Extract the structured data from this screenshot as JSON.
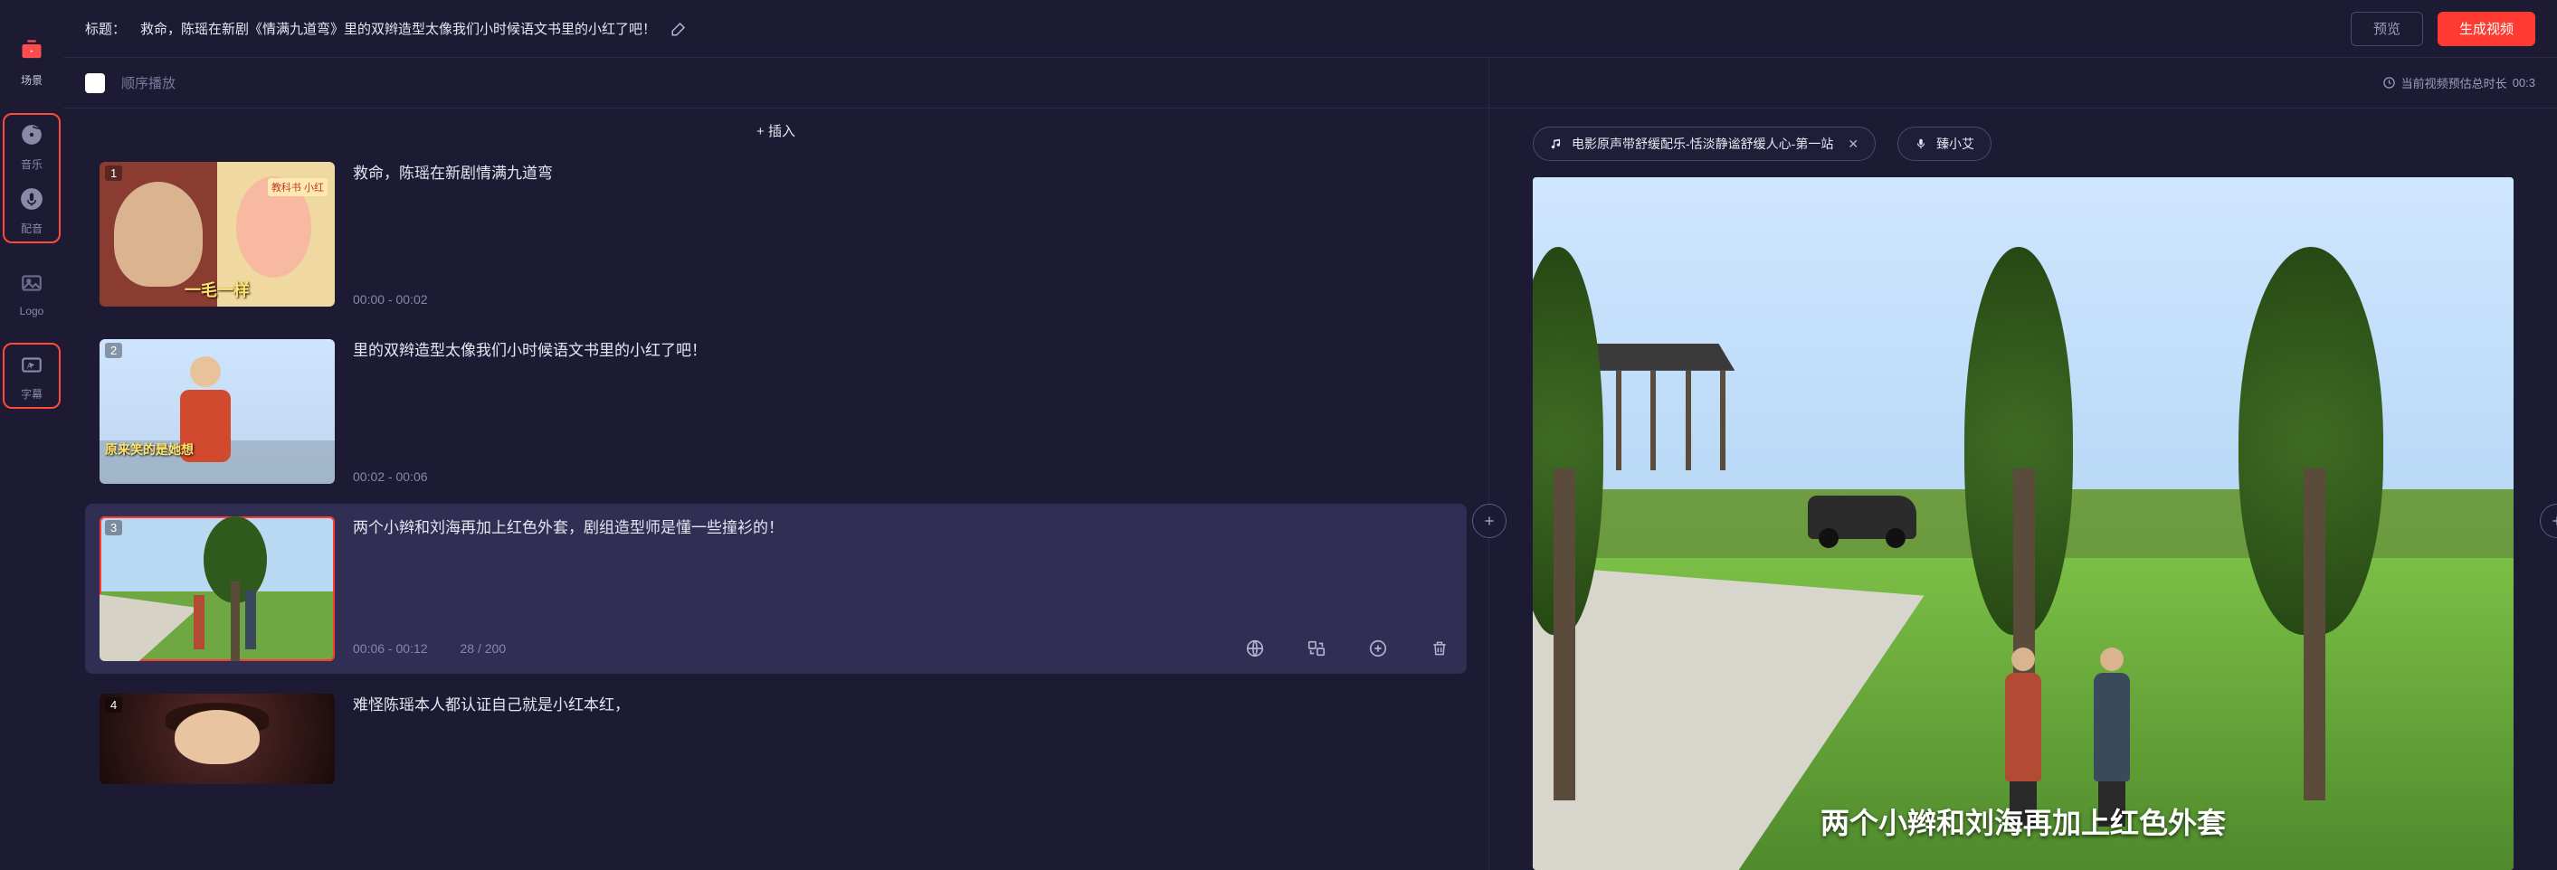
{
  "header": {
    "title_label": "标题：",
    "title_text": "救命，陈瑶在新剧《情满九道弯》里的双辫造型太像我们小时候语文书里的小红了吧！",
    "preview_btn": "预览",
    "generate_btn": "生成视频"
  },
  "sidebar": {
    "scene": "场景",
    "music": "音乐",
    "voice": "配音",
    "logo": "Logo",
    "subtitle": "字幕"
  },
  "scenesPanel": {
    "sequential": "顺序播放",
    "insert": "+ 插入"
  },
  "scenes": [
    {
      "idx": "1",
      "text": "救命，陈瑶在新剧情满九道弯",
      "time": "00:00 - 00:02",
      "thumbText": "一毛一样",
      "thumbTag": "教科书 小红"
    },
    {
      "idx": "2",
      "text": "里的双辫造型太像我们小时候语文书里的小红了吧！",
      "time": "00:02 - 00:06",
      "thumbText": "原来笑的是她想"
    },
    {
      "idx": "3",
      "text": "两个小辫和刘海再加上红色外套，剧组造型师是懂一些撞衫的！",
      "time": "00:06 - 00:12",
      "count": "28 / 200"
    },
    {
      "idx": "4",
      "text": "难怪陈瑶本人都认证自己就是小红本红，",
      "time": ""
    }
  ],
  "preview": {
    "duration_label": "当前视频预估总时长",
    "duration_value": "00:3",
    "music_tag": "电影原声带舒缓配乐-恬淡静谧舒缓人心-第一站",
    "voice_tag": "臻小艾",
    "caption": "两个小辫和刘海再加上红色外套"
  }
}
